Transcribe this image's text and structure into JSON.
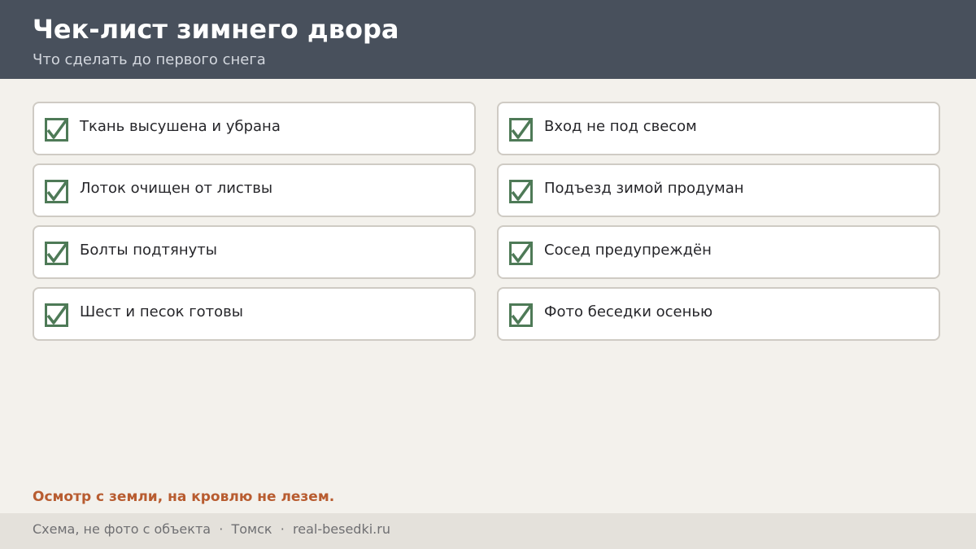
{
  "header": {
    "title": "Чек-лист зимнего двора",
    "subtitle": "Что сделать до первого снега"
  },
  "checklist": {
    "items": [
      {
        "label": "Ткань высушена и убрана",
        "checked": true
      },
      {
        "label": "Вход не под свесом",
        "checked": true
      },
      {
        "label": "Лоток очищен от листвы",
        "checked": true
      },
      {
        "label": "Подъезд зимой продуман",
        "checked": true
      },
      {
        "label": "Болты подтянуты",
        "checked": true
      },
      {
        "label": "Сосед предупреждён",
        "checked": true
      },
      {
        "label": "Шест и песок готовы",
        "checked": true
      },
      {
        "label": "Фото беседки осенью",
        "checked": true
      }
    ]
  },
  "note": "Осмотр с земли, на кровлю не лезем.",
  "footer": {
    "text": "Схема, не фото с объекта  ·  Томск  ·  real-besedki.ru"
  },
  "colors": {
    "header_bg": "#48505c",
    "page_bg": "#f3f1ec",
    "check_green": "#4e7a57",
    "note_orange": "#b85c30",
    "footer_bg": "#e4e1db"
  },
  "icons": {
    "check": "checkbox-checked-icon"
  }
}
